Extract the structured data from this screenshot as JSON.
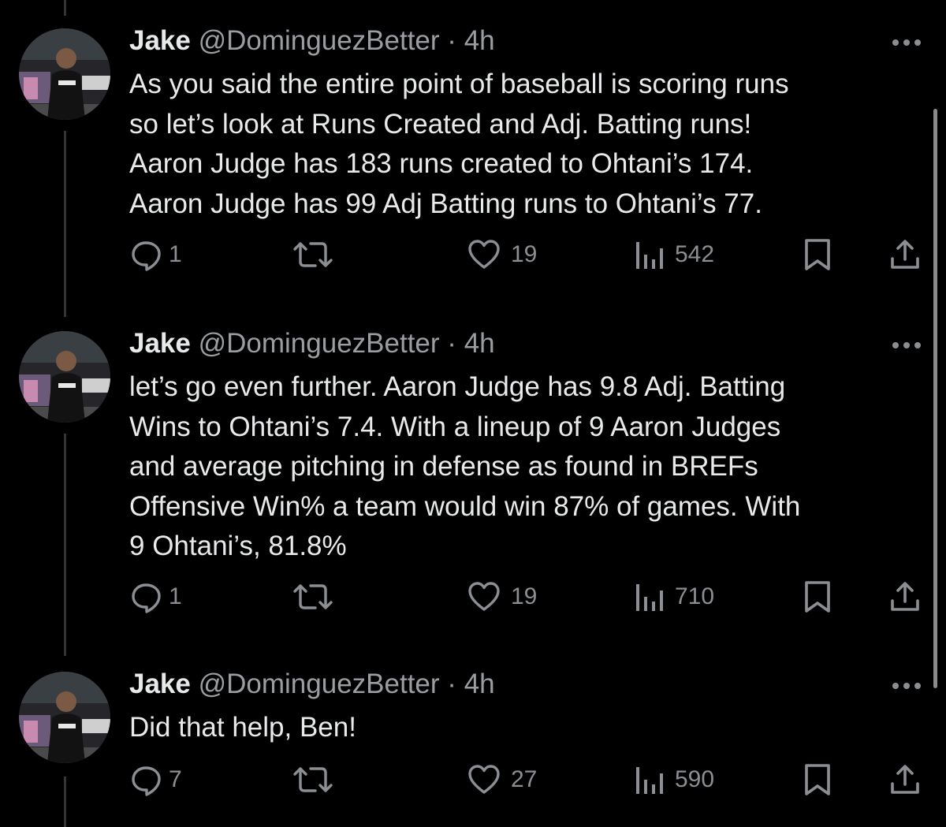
{
  "colors": {
    "background": "#000000",
    "text": "#e7e9ea",
    "secondary": "#9a9ea3",
    "icon": "#8b8f94",
    "thread_line": "#333639"
  },
  "tweets": [
    {
      "name": "Jake",
      "handle": "@DominguezBetter",
      "dot": "·",
      "time": "4h",
      "text": "As you said the entire point of baseball is scoring runs\nso let’s look at Runs Created and Adj. Batting runs!\nAaron Judge has 183 runs created to Ohtani’s 174.\nAaron Judge has 99 Adj Batting runs to Ohtani’s 77.",
      "replies": "1",
      "likes": "19",
      "views": "542",
      "icons": {
        "reply": "reply-icon",
        "retweet": "retweet-icon",
        "like": "heart-icon",
        "views": "views-icon",
        "bookmark": "bookmark-icon",
        "share": "share-icon",
        "more": "more-icon"
      }
    },
    {
      "name": "Jake",
      "handle": "@DominguezBetter",
      "dot": "·",
      "time": "4h",
      "text": "let’s go even further. Aaron Judge has 9.8 Adj. Batting\nWins to Ohtani’s 7.4. With a lineup of 9 Aaron Judges\nand average pitching in defense as found in BREFs\nOffensive Win% a team would win 87% of games. With\n9 Ohtani’s, 81.8%",
      "replies": "1",
      "likes": "19",
      "views": "710",
      "icons": {
        "reply": "reply-icon",
        "retweet": "retweet-icon",
        "like": "heart-icon",
        "views": "views-icon",
        "bookmark": "bookmark-icon",
        "share": "share-icon",
        "more": "more-icon"
      }
    },
    {
      "name": "Jake",
      "handle": "@DominguezBetter",
      "dot": "·",
      "time": "4h",
      "text": "Did that help, Ben!",
      "replies": "7",
      "likes": "27",
      "views": "590",
      "icons": {
        "reply": "reply-icon",
        "retweet": "retweet-icon",
        "like": "heart-icon",
        "views": "views-icon",
        "bookmark": "bookmark-icon",
        "share": "share-icon",
        "more": "more-icon"
      }
    }
  ]
}
